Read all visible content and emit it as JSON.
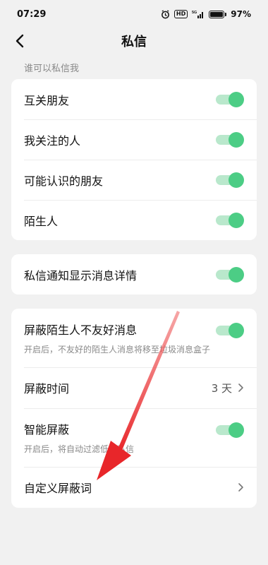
{
  "status": {
    "time": "07:29",
    "hd": "HD",
    "network": "5G",
    "battery": "97%",
    "battery_level": 0.97
  },
  "nav": {
    "title": "私信"
  },
  "section_label": "谁可以私信我",
  "who_can_message": [
    {
      "label": "互关朋友",
      "on": true
    },
    {
      "label": "我关注的人",
      "on": true
    },
    {
      "label": "可能认识的朋友",
      "on": true
    },
    {
      "label": "陌生人",
      "on": true
    }
  ],
  "notify": {
    "label": "私信通知显示消息详情",
    "on": true
  },
  "block": {
    "stranger": {
      "label": "屏蔽陌生人不友好消息",
      "sub": "开启后，不友好的陌生人消息将移至垃圾消息盒子",
      "on": true
    },
    "time": {
      "label": "屏蔽时间",
      "value": "3 天"
    },
    "smart": {
      "label": "智能屏蔽",
      "sub": "开启后，将自动过滤低质私信",
      "on": true
    },
    "custom": {
      "label": "自定义屏蔽词"
    }
  },
  "colors": {
    "toggle_on": "#4ccd85",
    "toggle_track": "#b9e8cc",
    "annotation_arrow": "#e8262a"
  }
}
